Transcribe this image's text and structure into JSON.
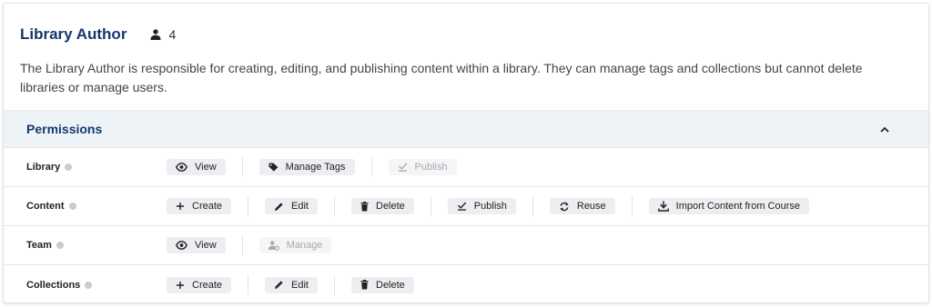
{
  "role": {
    "title": "Library Author",
    "user_count": "4",
    "description": "The Library Author is responsible for creating, editing, and publishing content within a library. They can manage tags and collections but cannot delete libraries or manage users."
  },
  "permissions": {
    "title": "Permissions",
    "rows": [
      {
        "label": "Library",
        "actions": [
          {
            "label": "View",
            "icon": "eye-icon",
            "enabled": true
          },
          {
            "label": "Manage Tags",
            "icon": "tag-icon",
            "enabled": true
          },
          {
            "label": "Publish",
            "icon": "publish-icon",
            "enabled": false
          }
        ]
      },
      {
        "label": "Content",
        "actions": [
          {
            "label": "Create",
            "icon": "plus-icon",
            "enabled": true
          },
          {
            "label": "Edit",
            "icon": "pencil-icon",
            "enabled": true
          },
          {
            "label": "Delete",
            "icon": "trash-icon",
            "enabled": true
          },
          {
            "label": "Publish",
            "icon": "publish-icon",
            "enabled": true
          },
          {
            "label": "Reuse",
            "icon": "sync-icon",
            "enabled": true
          },
          {
            "label": "Import Content from Course",
            "icon": "download-icon",
            "enabled": true
          }
        ]
      },
      {
        "label": "Team",
        "actions": [
          {
            "label": "View",
            "icon": "eye-icon",
            "enabled": true
          },
          {
            "label": "Manage",
            "icon": "user-settings-icon",
            "enabled": false
          }
        ]
      },
      {
        "label": "Collections",
        "actions": [
          {
            "label": "Create",
            "icon": "plus-icon",
            "enabled": true
          },
          {
            "label": "Edit",
            "icon": "pencil-icon",
            "enabled": true
          },
          {
            "label": "Delete",
            "icon": "trash-icon",
            "enabled": true
          }
        ]
      }
    ]
  },
  "colors": {
    "title": "#15376d",
    "permissions_bar": "#eef3f8",
    "chip": "#eceef1",
    "chip_disabled_text": "#a6a9ad"
  }
}
